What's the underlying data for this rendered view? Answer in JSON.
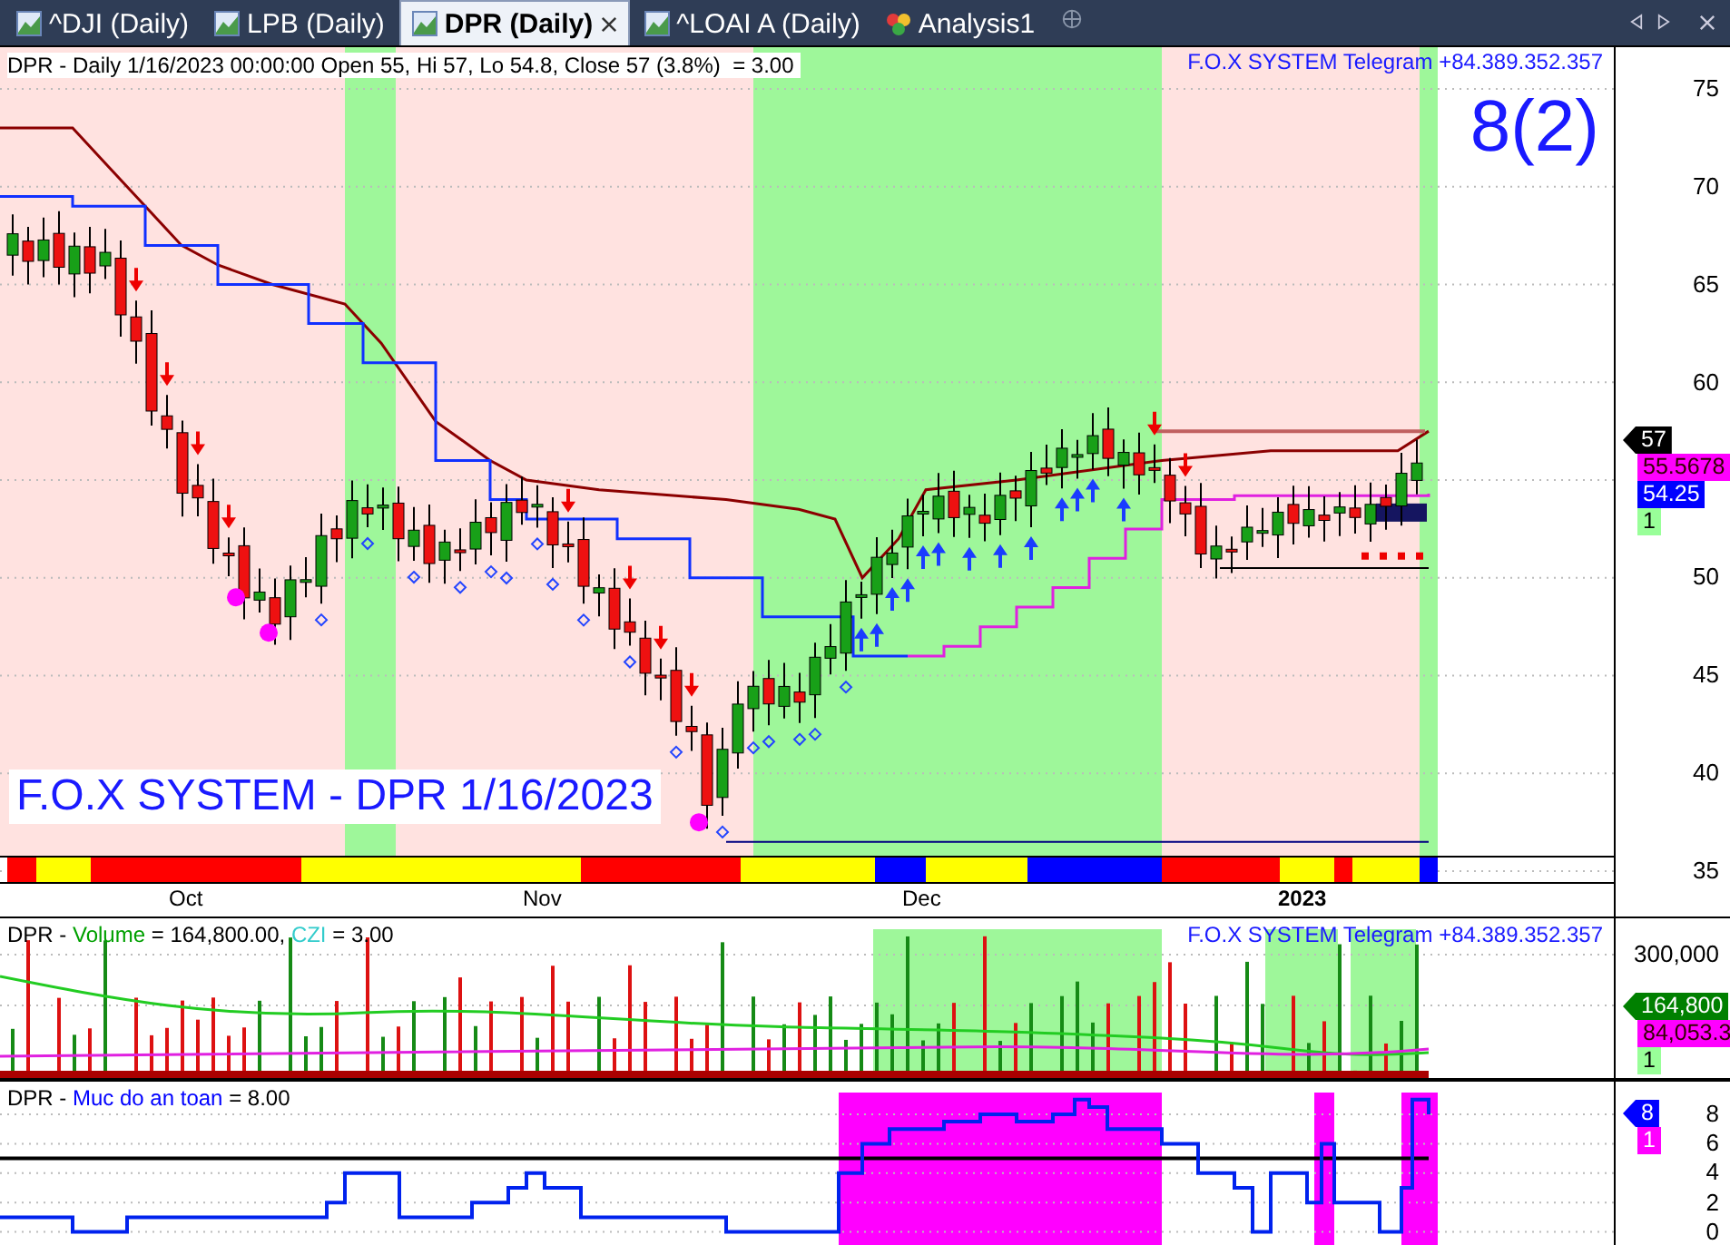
{
  "tabs": [
    {
      "label": "^DJI (Daily)",
      "kind": "chart",
      "selected": false
    },
    {
      "label": "LPB (Daily)",
      "kind": "chart",
      "selected": false
    },
    {
      "label": "DPR (Daily)",
      "kind": "chart",
      "selected": true
    },
    {
      "label": "^LOAI A (Daily)",
      "kind": "chart",
      "selected": false
    },
    {
      "label": "Analysis1",
      "kind": "analysis",
      "selected": false
    }
  ],
  "price_pane": {
    "header": "DPR - Daily 1/16/2023 00:00:00 Open 55, Hi 57, Lo 54.8, Close 57 (3.8%)  = 3.00",
    "contact": "F.O.X SYSTEM Telegram +84.389.352.357",
    "signal": "8(2)",
    "watermark_title": "F.O.X SYSTEM - DPR 1/16/2023",
    "axis_ticks": [
      "75",
      "70",
      "65",
      "60",
      "50",
      "45",
      "40",
      "35"
    ],
    "tags": [
      {
        "label": "57",
        "kind": "pointer",
        "color": "#000000"
      },
      {
        "label": "55.5678",
        "kind": "box",
        "color": "#ff00ff"
      },
      {
        "label": "54.25",
        "kind": "box",
        "color": "#0000ff"
      },
      {
        "label": "1",
        "kind": "box",
        "color": "#99ff99"
      }
    ],
    "date_labels": [
      "Oct",
      "Nov",
      "Dec",
      "2023"
    ]
  },
  "volume_pane": {
    "header": [
      {
        "text": "DPR - ",
        "color": "#000000"
      },
      {
        "text": "Volume",
        "color": "#00a000"
      },
      {
        "text": " = 164,800.00, ",
        "color": "#000000"
      },
      {
        "text": "CZI",
        "color": "#33cccc"
      },
      {
        "text": " = 3.00",
        "color": "#000000"
      }
    ],
    "contact": "F.O.X SYSTEM Telegram +84.389.352.357",
    "axis_ticks": [
      "300,000"
    ],
    "tags": [
      {
        "label": "164,800",
        "kind": "pointer",
        "color": "#008000"
      },
      {
        "label": "84,053.3",
        "kind": "box",
        "color": "#ff00ff"
      },
      {
        "label": "1",
        "kind": "box",
        "color": "#99ff99"
      }
    ]
  },
  "safety_pane": {
    "header": [
      {
        "text": "DPR - ",
        "color": "#000000"
      },
      {
        "text": "Muc do an toan",
        "color": "#0000ff"
      },
      {
        "text": " = 8.00",
        "color": "#000000"
      }
    ],
    "axis_ticks": [
      "8",
      "6",
      "4",
      "2",
      "0"
    ],
    "tags": [
      {
        "label": "8",
        "kind": "pointer",
        "color": "#0000ff"
      },
      {
        "label": "1",
        "kind": "box",
        "color": "#ff00ff"
      }
    ]
  }
}
